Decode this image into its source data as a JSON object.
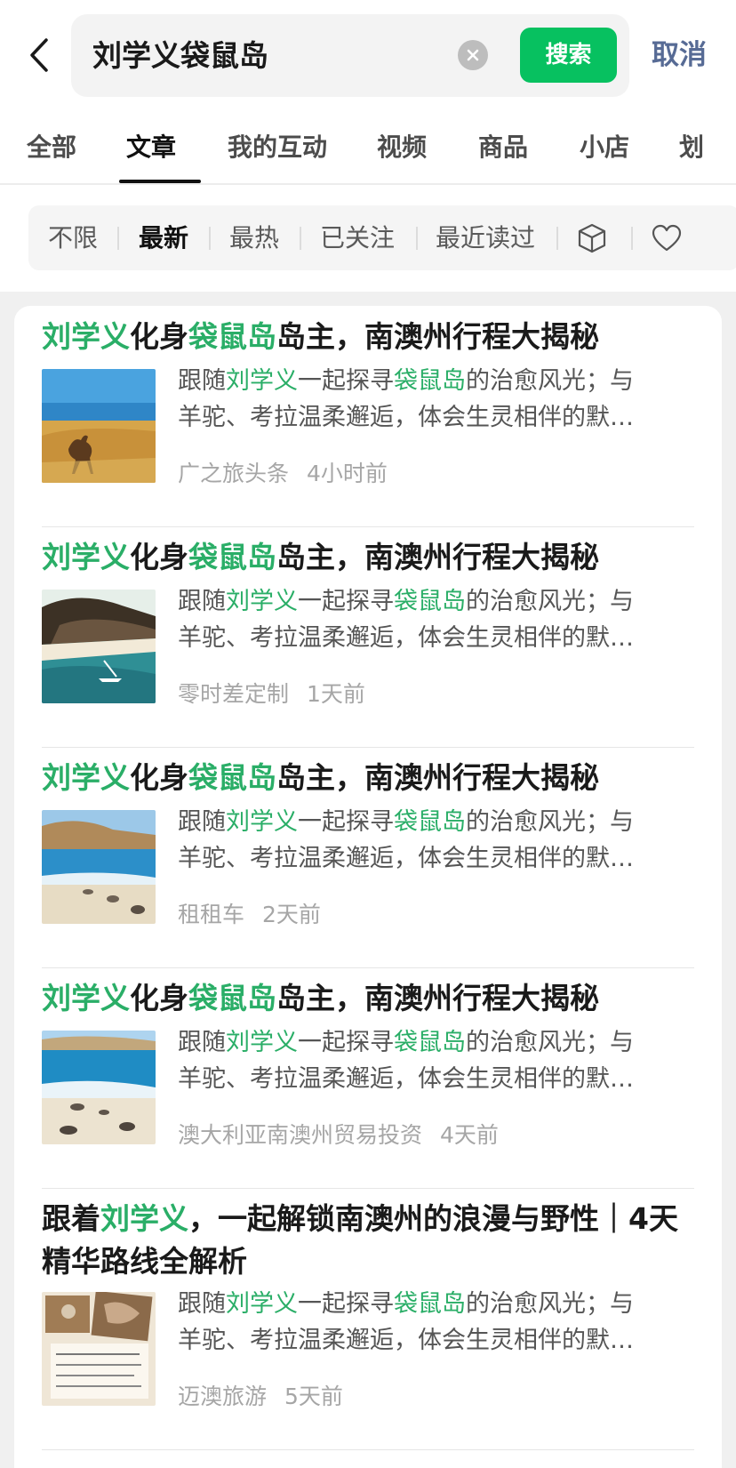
{
  "search": {
    "query": "刘学义袋鼠岛",
    "button_label": "搜索",
    "cancel_label": "取消"
  },
  "tabs": [
    {
      "label": "全部"
    },
    {
      "label": "文章"
    },
    {
      "label": "我的互动"
    },
    {
      "label": "视频"
    },
    {
      "label": "商品"
    },
    {
      "label": "小店"
    },
    {
      "label": "划"
    }
  ],
  "active_tab": "文章",
  "filters": [
    {
      "label": "不限"
    },
    {
      "label": "最新"
    },
    {
      "label": "最热"
    },
    {
      "label": "已关注"
    },
    {
      "label": "最近读过"
    }
  ],
  "active_filter": "最新",
  "filter_icons": [
    "cube-icon",
    "heart-icon"
  ],
  "colors": {
    "accent_green": "#07c160",
    "highlight_green": "#2aae67",
    "link_blue": "#576b95"
  },
  "results": [
    {
      "title": [
        "刘学义",
        "化身",
        "袋鼠岛",
        "岛主，南澳州行程大揭秘"
      ],
      "desc_line1": [
        "跟随",
        "刘学义",
        "一起探寻",
        "袋鼠岛",
        "的治愈风光；与"
      ],
      "desc_line2": "羊驼、考拉温柔邂逅，体会生灵相伴的默…",
      "source": "广之旅头条",
      "time": "4小时前"
    },
    {
      "title": [
        "刘学义",
        "化身",
        "袋鼠岛",
        "岛主，南澳州行程大揭秘"
      ],
      "desc_line1": [
        "跟随",
        "刘学义",
        "一起探寻",
        "袋鼠岛",
        "的治愈风光；与"
      ],
      "desc_line2": "羊驼、考拉温柔邂逅，体会生灵相伴的默…",
      "source": "零时差定制",
      "time": "1天前"
    },
    {
      "title": [
        "刘学义",
        "化身",
        "袋鼠岛",
        "岛主，南澳州行程大揭秘"
      ],
      "desc_line1": [
        "跟随",
        "刘学义",
        "一起探寻",
        "袋鼠岛",
        "的治愈风光；与"
      ],
      "desc_line2": "羊驼、考拉温柔邂逅，体会生灵相伴的默…",
      "source": "租租车",
      "time": "2天前"
    },
    {
      "title": [
        "刘学义",
        "化身",
        "袋鼠岛",
        "岛主，南澳州行程大揭秘"
      ],
      "desc_line1": [
        "跟随",
        "刘学义",
        "一起探寻",
        "袋鼠岛",
        "的治愈风光；与"
      ],
      "desc_line2": "羊驼、考拉温柔邂逅，体会生灵相伴的默…",
      "source": "澳大利亚南澳州贸易投资",
      "time": "4天前"
    },
    {
      "title": [
        "跟着",
        "刘学义",
        "，一起解锁南澳州的浪漫与野性｜4天精华路线全解析"
      ],
      "desc_line1": [
        "跟随",
        "刘学义",
        "一起探寻",
        "袋鼠岛",
        "的治愈风光；与"
      ],
      "desc_line2": "羊驼、考拉温柔邂逅，体会生灵相伴的默…",
      "source": "迈澳旅游",
      "time": "5天前"
    }
  ]
}
